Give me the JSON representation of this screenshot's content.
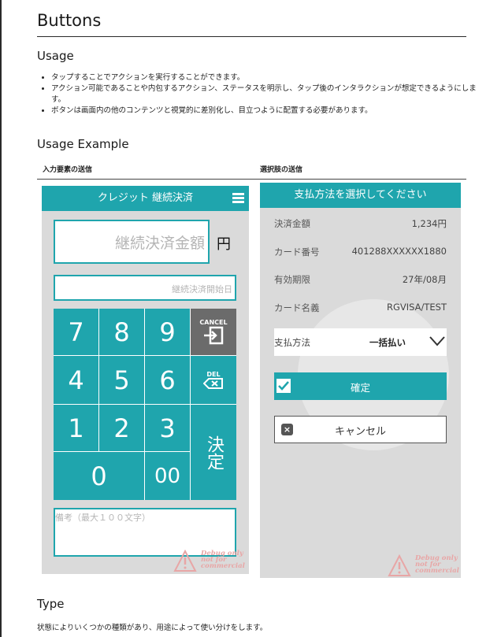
{
  "page": {
    "title": "Buttons",
    "usage_heading": "Usage",
    "usage_bullets": [
      "タップすることでアクションを実行することができます。",
      "アクション可能であることや内包するアクション、ステータスを明示し、タップ後のインタラクションが想定できるようにします。",
      "ボタンは画面内の他のコンテンツと視覚的に差別化し、目立つように配置する必要があります。"
    ],
    "usage_example_heading": "Usage Example",
    "example_left_label": "入力要素の送信",
    "example_right_label": "選択肢の送信",
    "type_heading": "Type",
    "type_description": "状態によりいくつかの種類があり、用途によって使い分けをします。"
  },
  "left_mock": {
    "header_title": "クレジット 継続決済",
    "amount_placeholder": "継続決済金額",
    "currency": "円",
    "start_date_placeholder": "継続決済開始日",
    "keys": {
      "k7": "7",
      "k8": "8",
      "k9": "9",
      "k4": "4",
      "k5": "5",
      "k6": "6",
      "k1": "1",
      "k2": "2",
      "k3": "3",
      "k0": "0",
      "k00": "00",
      "cancel": "CANCEL",
      "del": "DEL",
      "kettei": "決定"
    },
    "notes_placeholder": "備考（最大１００文字）",
    "debug_text": [
      "Debug only",
      "not for",
      "commercial"
    ]
  },
  "right_mock": {
    "header_title": "支払方法を選択してください",
    "rows": [
      {
        "label": "決済金額",
        "value": "1,234円"
      },
      {
        "label": "カード番号",
        "value": "401288XXXXXX1880"
      },
      {
        "label": "有効期限",
        "value": "27年/08月"
      },
      {
        "label": "カード名義",
        "value": "RGVISA/TEST"
      }
    ],
    "payment_method_label": "支払方法",
    "payment_method_value": "一括払い",
    "confirm_label": "確定",
    "cancel_label": "キャンセル",
    "debug_text": [
      "Debug only",
      "not for",
      "commercial"
    ]
  },
  "colors": {
    "accent": "#1fa5ad",
    "cancel_key": "#6b6b6b",
    "mock_background": "#dadada",
    "debug_text": "#e8a6a6"
  },
  "icons": [
    "menu-icon",
    "cancel-enter-icon",
    "backspace-icon",
    "chevron-down-icon",
    "checkbox-icon",
    "close-icon",
    "warning-icon"
  ]
}
